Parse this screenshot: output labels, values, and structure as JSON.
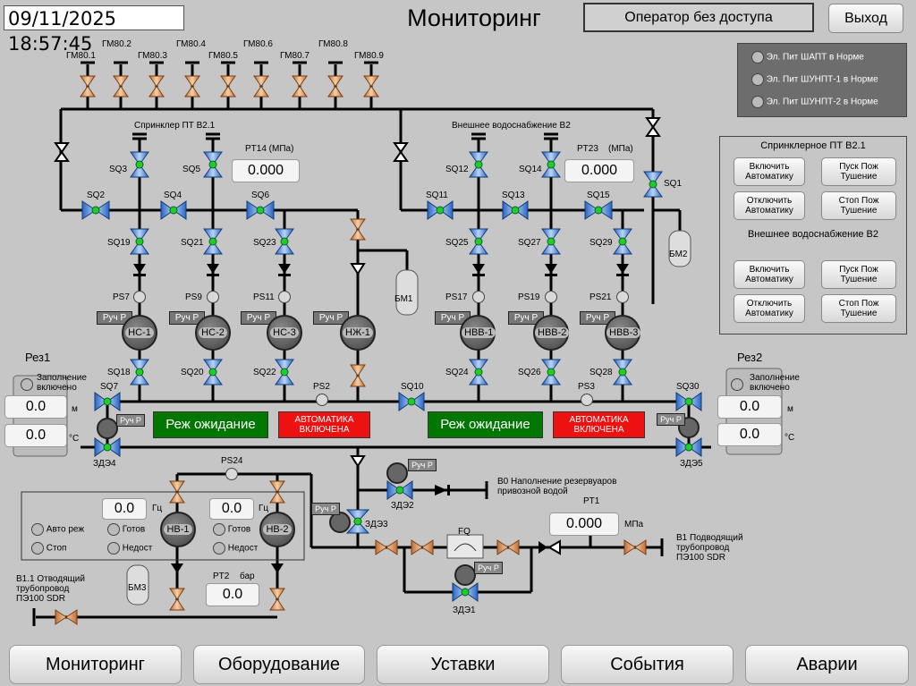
{
  "header": {
    "datetime": "09/11/2025 18:57:45",
    "title": "Мониторинг",
    "operator": "Оператор без доступа",
    "exit": "Выход"
  },
  "power_status": [
    {
      "label": "Эл. Пит ШАПТ в Норме"
    },
    {
      "label": "Эл. Пит ШУНПТ-1 в Норме"
    },
    {
      "label": "Эл. Пит ШУНПТ-2 в Норме"
    }
  ],
  "control": {
    "sprinkler_title": "Спринклерное ПТ В2.1",
    "external_title": "Внешнее водоснабжение В2",
    "btn_enable_auto": "Включить Автоматику",
    "btn_disable_auto": "Отключить Автоматику",
    "btn_start": "Пуск Пож Тушение",
    "btn_stop": "Стоп Пож Тушение"
  },
  "gm_labels": [
    "ГМ80.1",
    "ГМ80.2",
    "ГМ80.3",
    "ГМ80.4",
    "ГМ80.5",
    "ГМ80.6",
    "ГМ80.7",
    "ГМ80.8",
    "ГМ80.9"
  ],
  "diagram": {
    "sprinkler_pt": "Спринклер ПТ В2.1",
    "external_supply": "Внешнее водоснабжение В2",
    "pt14_label": "PT14 (МПа)",
    "pt14_value": "0.000",
    "pt23_label": "PT23",
    "pt23_unit": "(МПа)",
    "pt23_value": "0.000",
    "bm1": "БМ1",
    "bm2": "БМ2",
    "bm3": "БМ3",
    "ruch": "Руч Р",
    "pumps": [
      "НС-1",
      "НС-2",
      "НС-3",
      "НЖ-1",
      "НВВ-1",
      "НВВ-2",
      "НВВ-3"
    ],
    "ps_labels": [
      "PS7",
      "PS9",
      "PS11",
      "PS17",
      "PS19",
      "PS21"
    ],
    "sq_top": [
      "SQ2",
      "SQ3",
      "SQ4",
      "SQ5",
      "SQ6",
      "SQ11",
      "SQ12",
      "SQ13",
      "SQ14",
      "SQ15",
      "SQ1"
    ],
    "sq_mid": [
      "SQ19",
      "SQ21",
      "SQ23",
      "SQ25",
      "SQ27",
      "SQ29"
    ],
    "sq_low": [
      "SQ18",
      "SQ20",
      "SQ22",
      "SQ24",
      "SQ26",
      "SQ28"
    ],
    "sq7": "SQ7",
    "sq10": "SQ10",
    "sq30": "SQ30",
    "ps2": "PS2",
    "ps3": "PS3",
    "ps24": "PS24",
    "mode_left": "Реж ожидание",
    "mode_right": "Реж ожидание",
    "auto_on": "АВТОМАТИКА ВКЛЮЧЕНА",
    "res1": "Рез1",
    "res2": "Рез2",
    "filling": "Заполнение включено",
    "res1_level": "0.0",
    "res1_temp": "0.0",
    "res2_level": "0.0",
    "res2_temp": "0.0",
    "unit_m": "м",
    "unit_c": "°С",
    "zde4": "ЗДЭ4",
    "zde5": "ЗДЭ5",
    "zde3": "ЗДЭ3",
    "zde2": "ЗДЭ2",
    "zde1": "ЗДЭ1",
    "b0": "В0 Наполнение резервуаров привозной водой",
    "pt1": "PT1",
    "pt1_value": "0.000",
    "pt1_unit": "МПа",
    "fq": "FQ",
    "b1": "В1 Подводящий трубопровод ПЭ100 SDR",
    "b11": "В1.1 Отводящий трубопровод ПЭ100 SDR",
    "pt2_label": "PT2",
    "pt2_unit": "бар",
    "pt2_value": "0.0",
    "nv1": "НВ-1",
    "nv2": "НВ-2",
    "hz": "Гц",
    "nv1_hz": "0.0",
    "nv2_hz": "0.0",
    "auto_mode": "Авто реж",
    "stop": "Стоп",
    "ready": "Готов",
    "unavail": "Недост"
  },
  "nav": [
    "Мониторинг",
    "Оборудование",
    "Уставки",
    "События",
    "Аварии"
  ],
  "colors": {
    "bg": "#c6c6c6",
    "valve_green": "#22cc22",
    "standby_bg": "#007700",
    "auto_red": "#ee1111"
  }
}
